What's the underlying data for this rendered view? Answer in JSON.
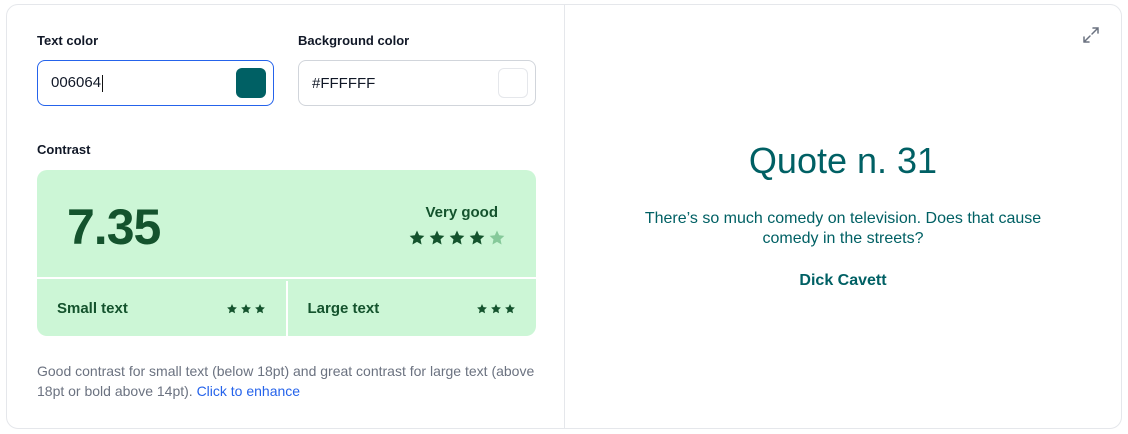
{
  "text_color": {
    "label": "Text color",
    "value": "006064",
    "swatch": "#006064"
  },
  "background_color": {
    "label": "Background color",
    "value": "#FFFFFF",
    "swatch": "#FFFFFF"
  },
  "contrast": {
    "label": "Contrast",
    "ratio": "7.35",
    "rating": "Very good",
    "stars_filled": 4,
    "stars_total": 5,
    "small_text": {
      "label": "Small text",
      "stars": 3
    },
    "large_text": {
      "label": "Large text",
      "stars": 3
    },
    "colors": {
      "panel": "#ccf6d6",
      "ink": "#14532d",
      "star_empty": "#86c99a"
    }
  },
  "note": {
    "text": "Good contrast for small text (below 18pt) and great contrast for large text (above 18pt or bold above 14pt).",
    "link": "Click to enhance"
  },
  "preview": {
    "title": "Quote n. 31",
    "quote": "There’s so much comedy on television. Does that cause comedy in the streets?",
    "author": "Dick Cavett",
    "expand_icon": "expand-icon"
  }
}
